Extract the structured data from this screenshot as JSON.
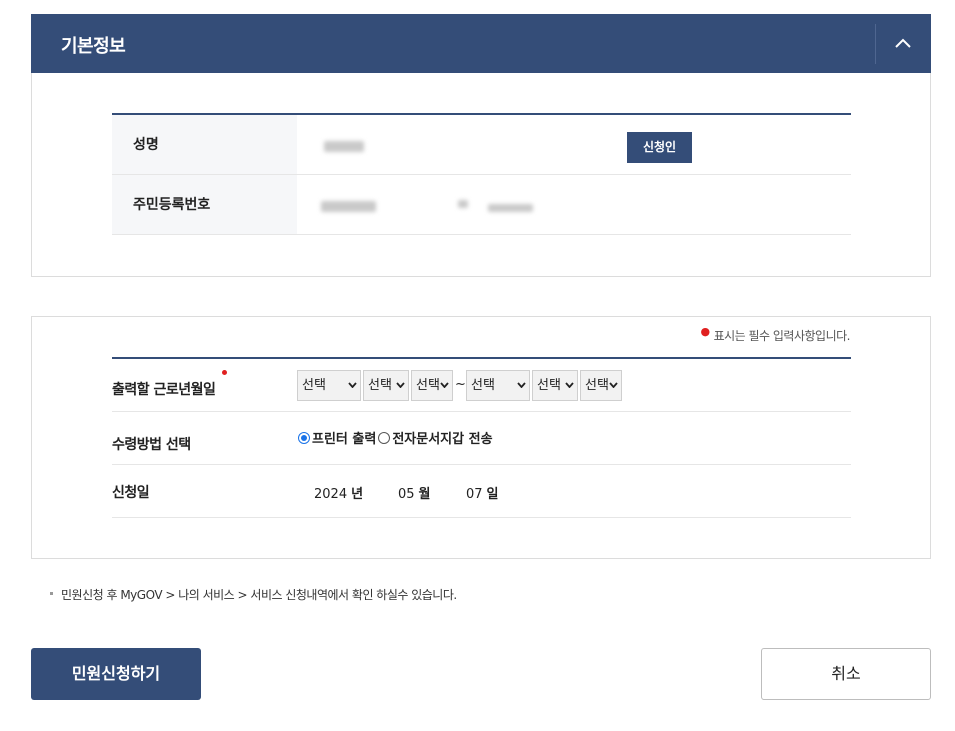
{
  "panel": {
    "title": "기본정보",
    "collapse_icon": "chevron-up-icon"
  },
  "basic_info": {
    "rows": [
      {
        "label": "성명",
        "badge": "신청인"
      },
      {
        "label": "주민등록번호"
      }
    ]
  },
  "form": {
    "required_note": "표시는 필수 입력사항입니다.",
    "work_period": {
      "label": "출력할 근로년월일",
      "from": [
        "선택",
        "선택",
        "선택"
      ],
      "separator": "~",
      "to": [
        "선택",
        "선택",
        "선택"
      ]
    },
    "receive_method": {
      "label": "수령방법 선택",
      "options": [
        {
          "label": "프린터 출력",
          "selected": true
        },
        {
          "label": "전자문서지갑 전송",
          "selected": false
        }
      ]
    },
    "apply_date": {
      "label": "신청일",
      "year": "2024",
      "year_unit": "년",
      "month": "05",
      "month_unit": "월",
      "day": "07",
      "day_unit": "일"
    }
  },
  "notice": "민원신청 후 MyGOV > 나의 서비스 > 서비스 신청내역에서 확인 하실수 있습니다.",
  "buttons": {
    "submit": "민원신청하기",
    "cancel": "취소"
  },
  "colors": {
    "primary": "#344d78",
    "required": "#e02020",
    "radio": "#1a73e8"
  }
}
